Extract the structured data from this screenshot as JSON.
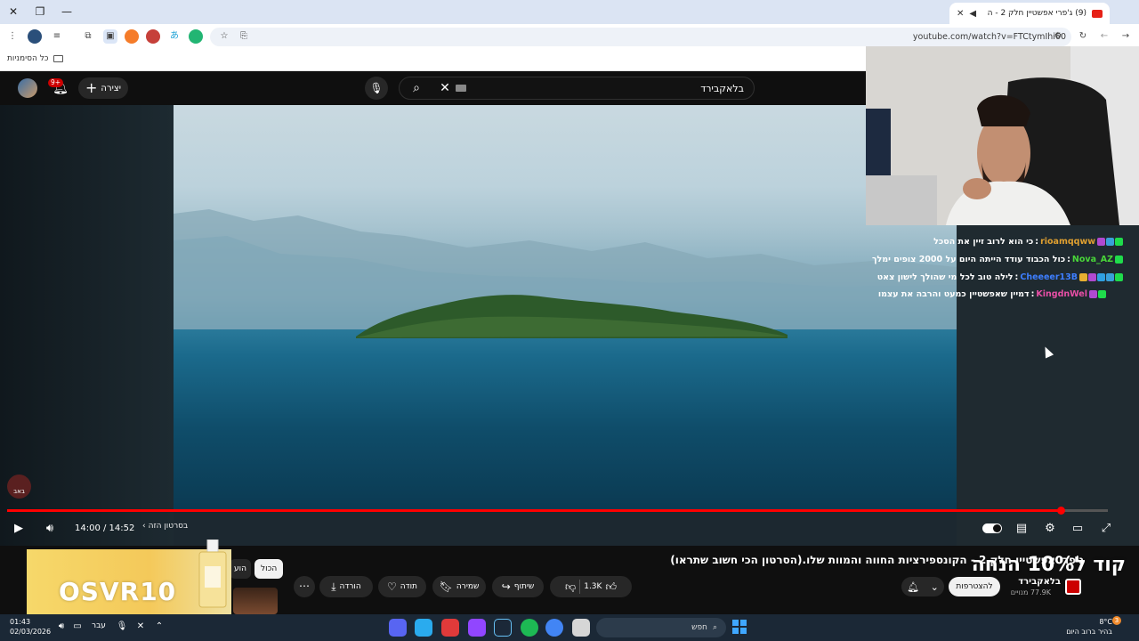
{
  "browser": {
    "tab_title": "(9) ג'פרי אפשטיין חלק 2 - ה",
    "url": "youtube.com/watch?v=FTCtymIhi60",
    "bookmarks_all": "כל הסימניות"
  },
  "youtube": {
    "notifications_badge": "9+",
    "create_label": "יצירה",
    "search_value": "בלאקבירד"
  },
  "player": {
    "current_time": "14:00",
    "duration": "14:52",
    "time_display": "14:00 / 14:52",
    "progress_fraction": 0.9574,
    "chapter_label": "בסרטון הזה",
    "watermark": "באב"
  },
  "chat": [
    {
      "user": "rioamqqww",
      "message": "כי הוא לרוב זיין את הסכל",
      "color": "#e0a030"
    },
    {
      "user": "Nova_AZ",
      "message": "כול הכבוד עודד הייתה היום על 2000 צופים ימלך",
      "color": "#49d639"
    },
    {
      "user": "Cheeeer13B",
      "message": "לילה טוב לכל מי שהולך לישון צאט",
      "color": "#3d7eff"
    },
    {
      "user": "KingdnWel",
      "message": "דמיין שאפשטיין כמעט והרבה את עצמו",
      "color": "#e84fa6"
    }
  ],
  "video": {
    "title": "ג'פרי אפשטיין חלק 2 - הקונספירציות החווה והמוות שלו.(הסרטון הכי חשוב שתראו)",
    "channel_name": "בלאקבירד",
    "subscribers": "77.9K מנויים",
    "subscribe_label": "להצטרפות",
    "likes": "1.3K",
    "share_label": "שיתוף",
    "save_label": "שמירה",
    "thanks_label": "תודה",
    "download_label": "הורדה"
  },
  "chips": {
    "all": "הכול",
    "second": "הוע"
  },
  "ad": {
    "line1": "קוד ל10% הנחה",
    "line2": "OSVR10"
  },
  "taskbar": {
    "time": "01:43",
    "date": "02/03/2026",
    "language": "עבר",
    "search_placeholder": "חפש",
    "temperature": "8°C",
    "weather_desc": "בהיר ברוב היום",
    "weather_badge": "3"
  }
}
